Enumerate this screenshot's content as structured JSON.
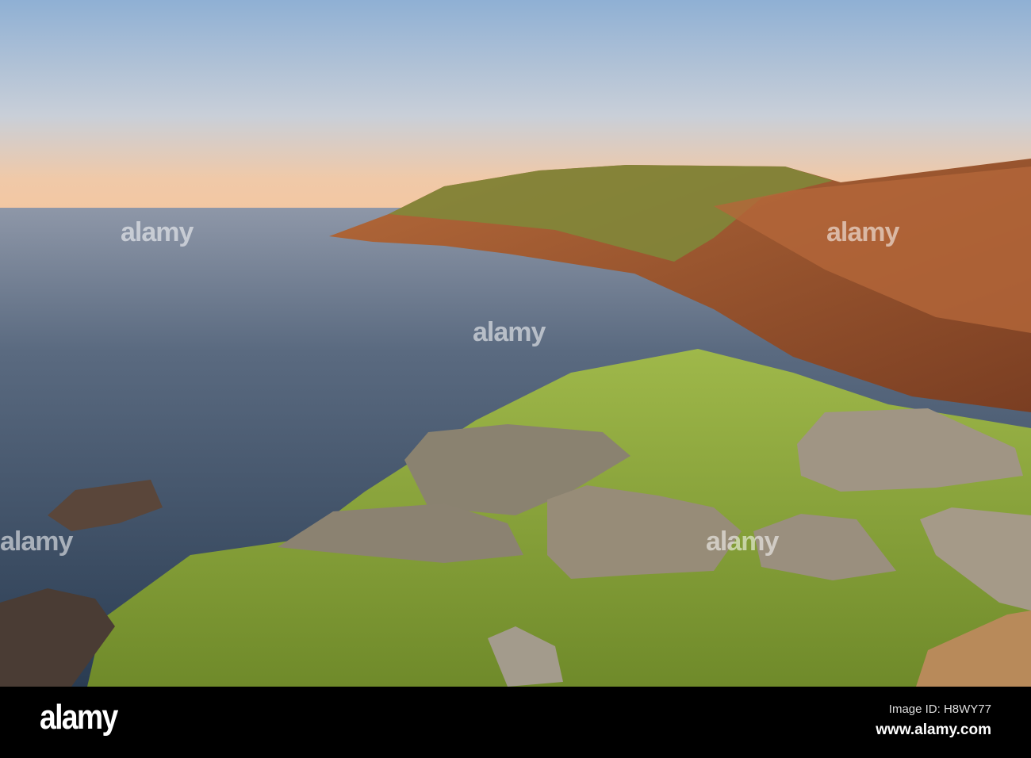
{
  "watermark": {
    "text": "alamy"
  },
  "footer": {
    "logo": "alamy",
    "image_id": "Image ID: H8WY77",
    "url": "www.alamy.com"
  }
}
